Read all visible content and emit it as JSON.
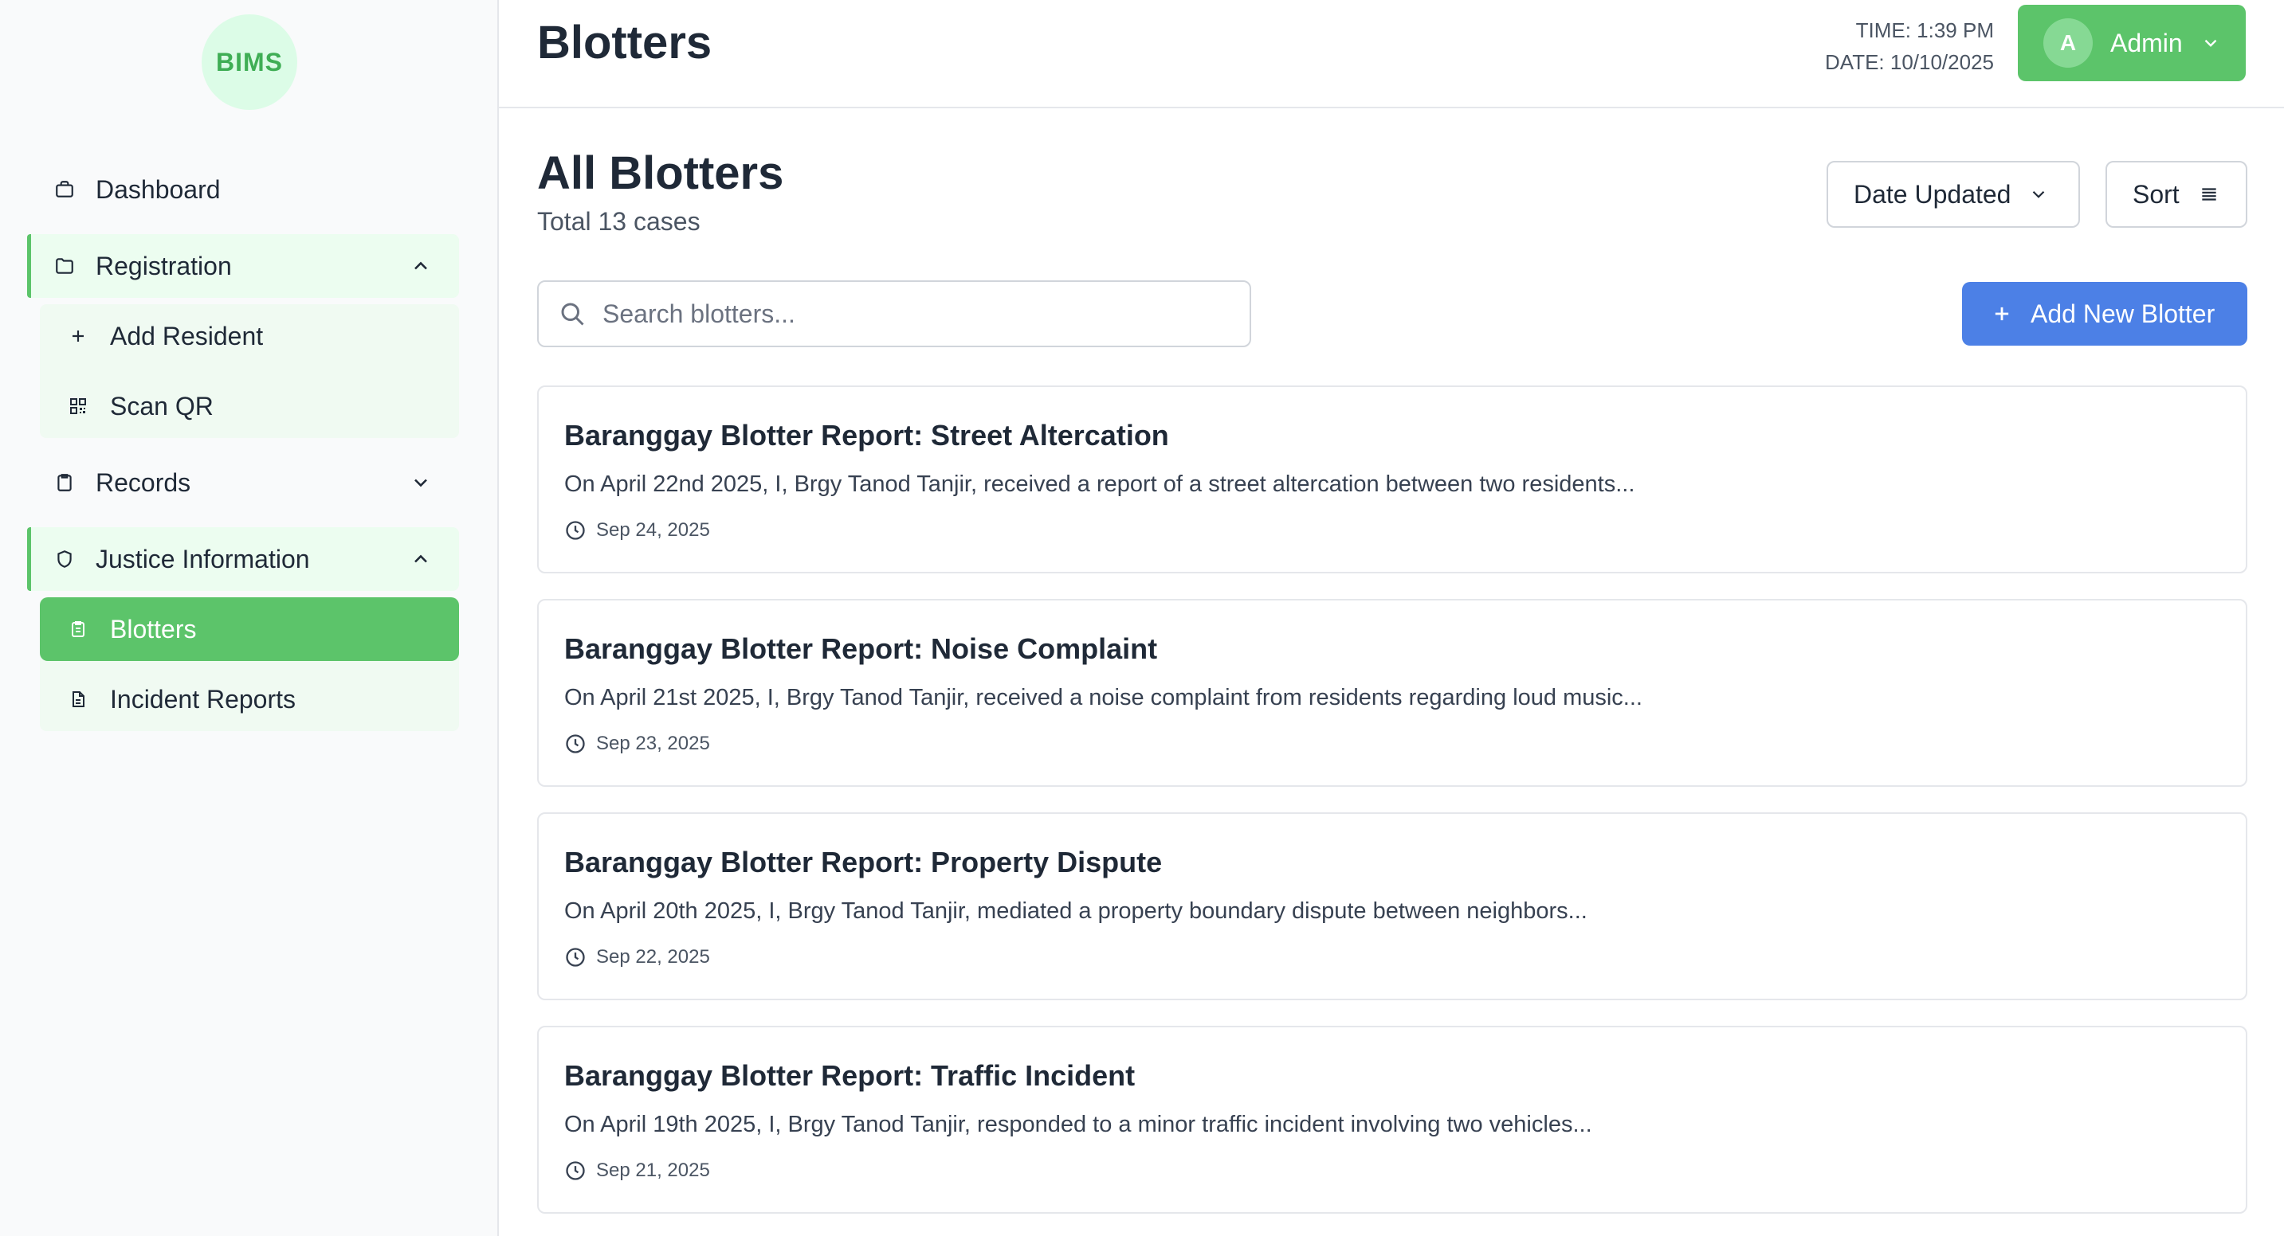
{
  "app": {
    "logo": "BIMS"
  },
  "sidebar": {
    "items": [
      {
        "label": "Dashboard",
        "icon": "briefcase-icon"
      },
      {
        "label": "Registration",
        "icon": "folder-icon",
        "expanded": true,
        "children": [
          {
            "label": "Add Resident",
            "icon": "plus-icon"
          },
          {
            "label": "Scan QR",
            "icon": "qr-code-icon"
          }
        ]
      },
      {
        "label": "Records",
        "icon": "clipboard-icon",
        "expanded": false
      },
      {
        "label": "Justice Information",
        "icon": "shield-icon",
        "expanded": true,
        "children": [
          {
            "label": "Blotters",
            "icon": "clipboard-list-icon",
            "active": true
          },
          {
            "label": "Incident Reports",
            "icon": "file-text-icon"
          }
        ]
      }
    ]
  },
  "header": {
    "title": "Blotters",
    "time": "TIME: 1:39 PM",
    "date": "DATE: 10/10/2025",
    "user": {
      "initial": "A",
      "name": "Admin"
    }
  },
  "main": {
    "title": "All Blotters",
    "subtitle": "Total 13 cases",
    "sort_dropdown": "Date Updated",
    "sort_button": "Sort",
    "search": {
      "placeholder": "Search blotters...",
      "value": ""
    },
    "add_button": "Add New Blotter",
    "cards": [
      {
        "title": "Baranggay Blotter Report: Street Altercation",
        "description": "On April 22nd 2025, I, Brgy Tanod Tanjir, received a report of a street altercation between two residents...",
        "date": "Sep 24, 2025"
      },
      {
        "title": "Baranggay Blotter Report: Noise Complaint",
        "description": "On April 21st 2025, I, Brgy Tanod Tanjir, received a noise complaint from residents regarding loud music...",
        "date": "Sep 23, 2025"
      },
      {
        "title": "Baranggay Blotter Report: Property Dispute",
        "description": "On April 20th 2025, I, Brgy Tanod Tanjir, mediated a property boundary dispute between neighbors...",
        "date": "Sep 22, 2025"
      },
      {
        "title": "Baranggay Blotter Report: Traffic Incident",
        "description": "On April 19th 2025, I, Brgy Tanod Tanjir, responded to a minor traffic incident involving two vehicles...",
        "date": "Sep 21, 2025"
      }
    ]
  },
  "colors": {
    "accent_green": "#5cc46a",
    "accent_blue": "#4c80e6",
    "logo_bg": "#dcfce7"
  }
}
